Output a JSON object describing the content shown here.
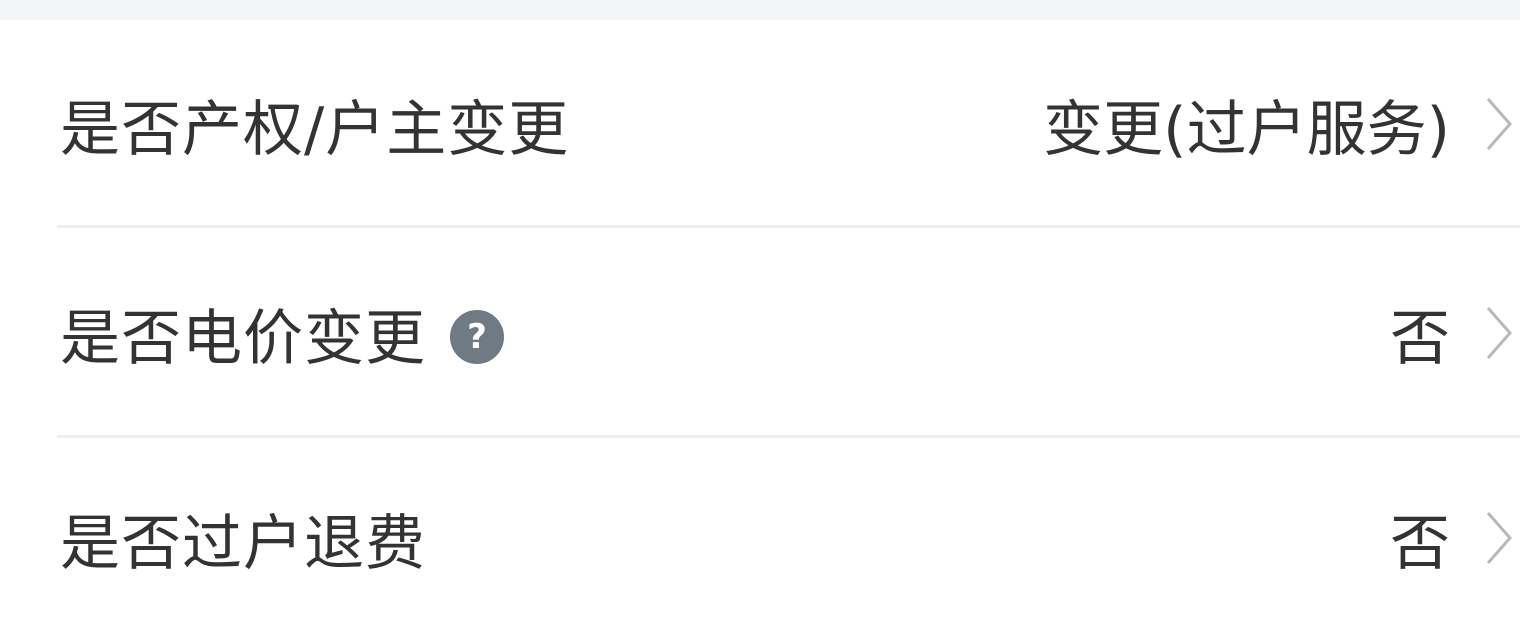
{
  "rows": [
    {
      "label": "是否产权/户主变更",
      "value": "变更(过户服务)",
      "has_help": false
    },
    {
      "label": "是否电价变更",
      "value": "否",
      "has_help": true,
      "help_glyph": "?"
    },
    {
      "label": "是否过户退费",
      "value": "否",
      "has_help": false
    }
  ],
  "icons": {
    "help": "question-circle-icon",
    "chevron": "chevron-right-icon"
  },
  "colors": {
    "text": "#333333",
    "divider": "#eeeeee",
    "help_icon_bg": "#6f7a85",
    "chevron": "#b8b8b8",
    "top_band": "#f4f5f7"
  }
}
